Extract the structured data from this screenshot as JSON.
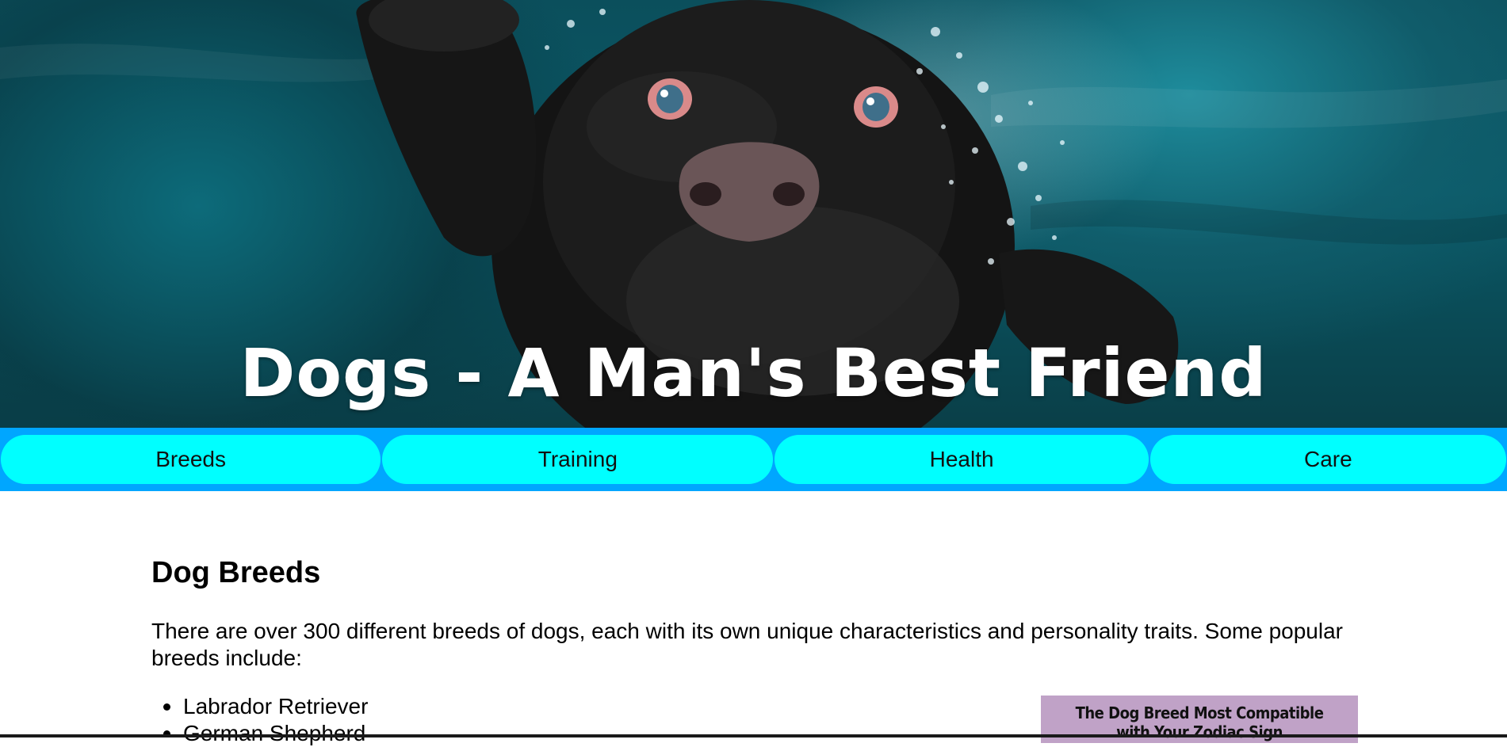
{
  "hero": {
    "title": "Dogs - A Man's Best Friend",
    "image": "underwater-black-dog-photo"
  },
  "nav": {
    "items": [
      {
        "label": "Breeds"
      },
      {
        "label": "Training"
      },
      {
        "label": "Health"
      },
      {
        "label": "Care"
      }
    ]
  },
  "main": {
    "heading": "Dog Breeds",
    "intro": "There are over 300 different breeds of dogs, each with its own unique characteristics and personality traits. Some popular breeds include:",
    "breeds": [
      "Labrador Retriever",
      "German Shepherd"
    ],
    "promo": {
      "line1": "The Dog Breed Most Compatible",
      "line2": "with Your Zodiac Sign"
    }
  },
  "colors": {
    "nav_bar": "#00a6ff",
    "nav_button": "#00ffff",
    "promo_bg": "#c0a2c7"
  }
}
